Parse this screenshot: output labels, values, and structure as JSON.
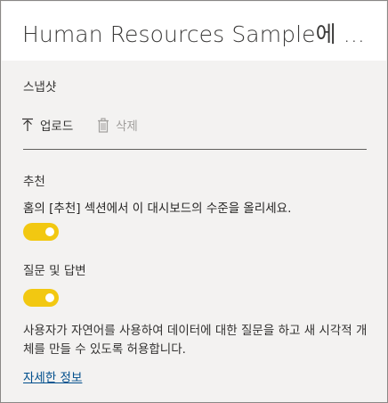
{
  "header": {
    "title": "Human Resources Sample에 ..."
  },
  "snapshot": {
    "label": "스냅샷",
    "upload_label": "업로드",
    "delete_label": "삭제"
  },
  "featured": {
    "label": "추천",
    "description": "홈의 [추천] 섹션에서 이 대시보드의 수준을 올리세요.",
    "enabled": true
  },
  "qa": {
    "label": "질문 및 답변",
    "enabled": true,
    "description": "사용자가 자연어를 사용하여 데이터에 대한 질문을 하고 새 시각적 개체를 만들 수 있도록 허용합니다."
  },
  "learn_more": "자세한 정보",
  "colors": {
    "toggle_on": "#f2c811",
    "link": "#004e8c",
    "panel_bg": "#f3f2f1"
  },
  "icons": {
    "upload": "upload-arrow-icon",
    "delete": "trash-icon"
  }
}
